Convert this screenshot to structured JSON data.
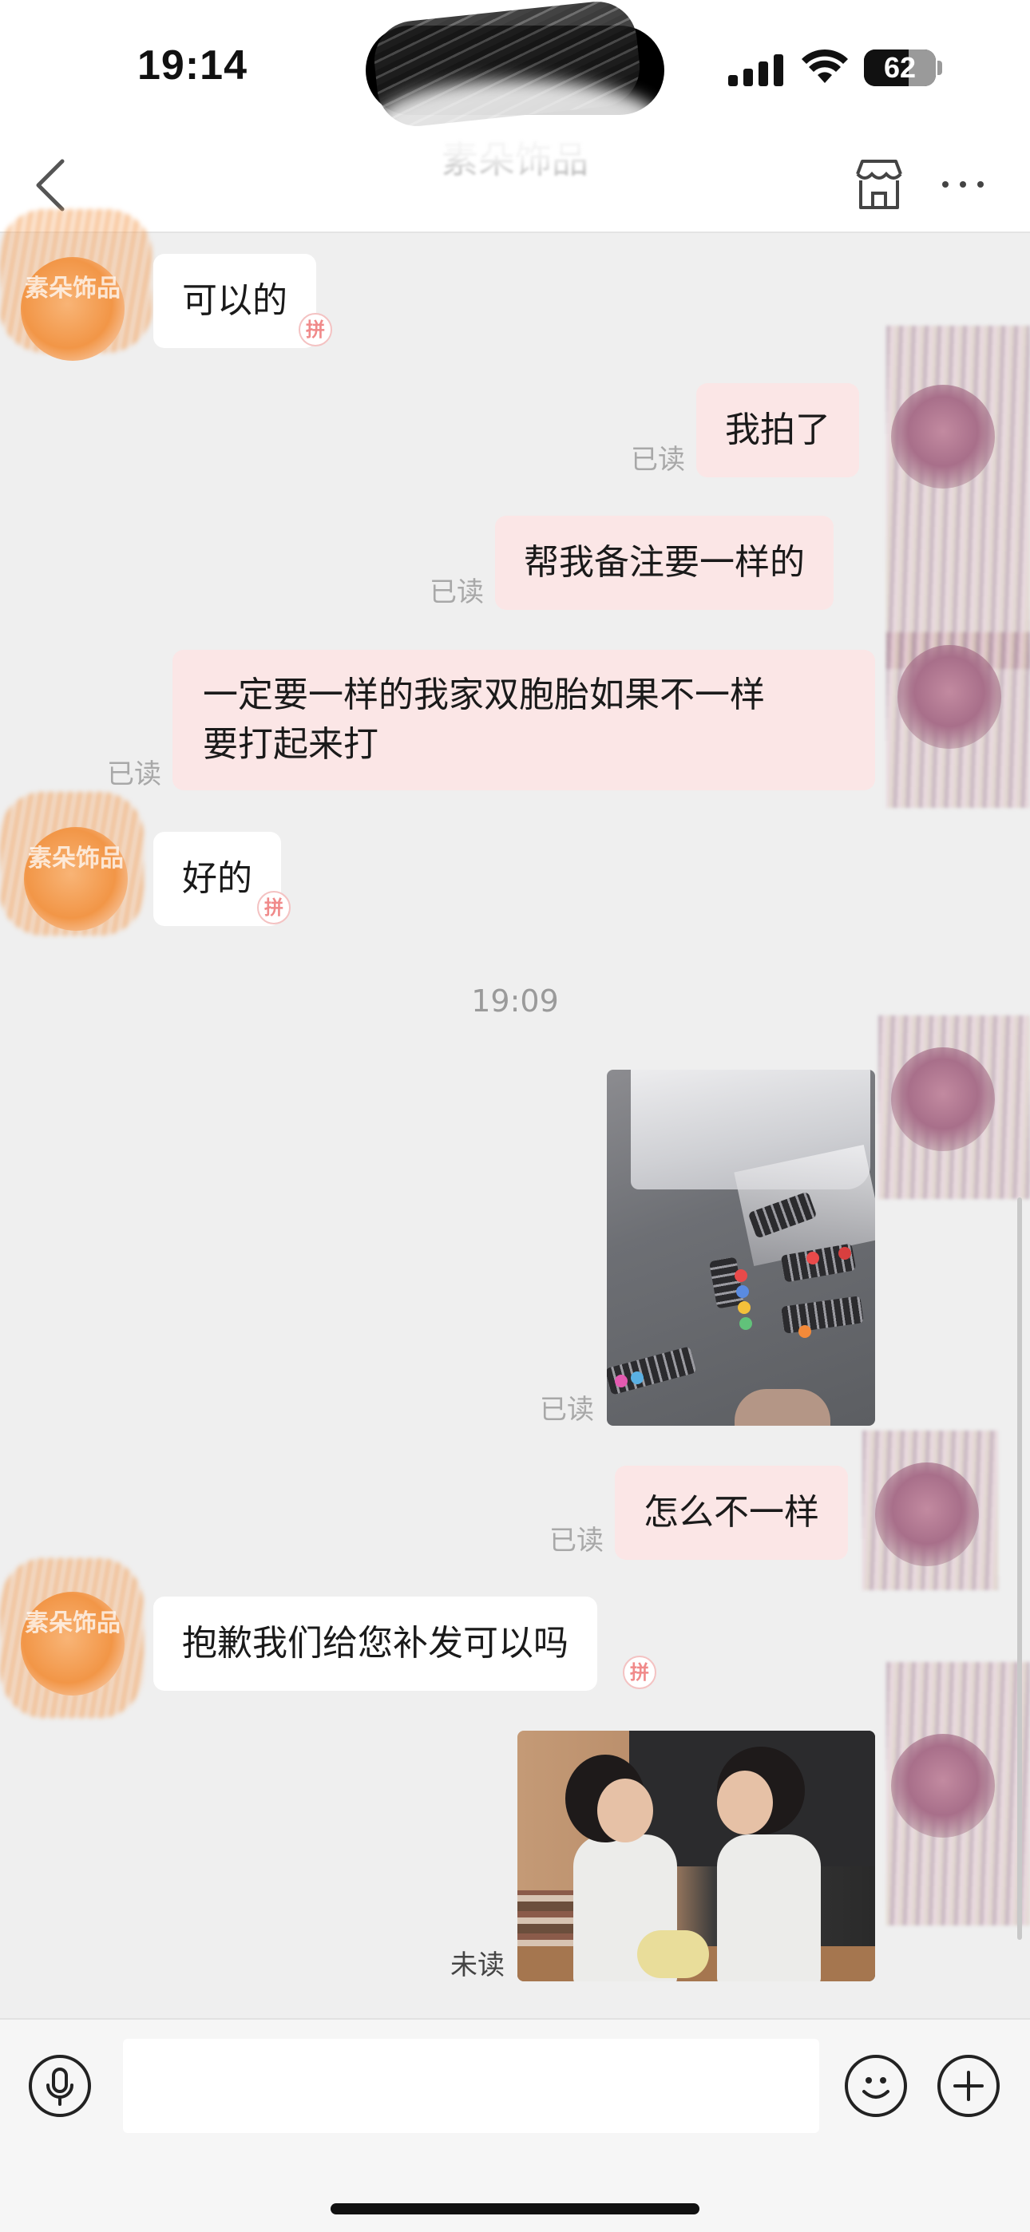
{
  "status_bar": {
    "time": "19:14",
    "battery": "62",
    "battery_fraction": 0.62,
    "signal_icon": "cellular-signal-icon",
    "wifi_icon": "wifi-icon"
  },
  "nav": {
    "title": "素朵饰品",
    "back_icon": "chevron-left-icon",
    "shop_icon": "shop-icon",
    "more_icon": "ellipsis-icon"
  },
  "messages": [
    {
      "from": "shop",
      "type": "text",
      "text": "可以的"
    },
    {
      "from": "me",
      "type": "text",
      "text": "我拍了",
      "status": "已读"
    },
    {
      "from": "me",
      "type": "text",
      "text": "帮我备注要一样的",
      "status": "已读"
    },
    {
      "from": "me",
      "type": "text",
      "lines": [
        "一定要一样的我家双胞胎如果不一样",
        "要打起来打"
      ],
      "status": "已读"
    },
    {
      "from": "shop",
      "type": "text",
      "text": "好的"
    },
    {
      "type": "timestamp",
      "text": "19:09"
    },
    {
      "from": "me",
      "type": "image",
      "subject": "photo-hair-clips",
      "status": "已读"
    },
    {
      "from": "me",
      "type": "text",
      "text": "怎么不一样",
      "status": "已读"
    },
    {
      "from": "shop",
      "type": "text",
      "text": "抱歉我们给您补发可以吗"
    },
    {
      "from": "me",
      "type": "image",
      "subject": "photo-children",
      "status": "未读"
    }
  ],
  "shop_avatar_text": "素朵饰品",
  "badge_text": "拼",
  "input_bar": {
    "placeholder": "",
    "mic_icon": "microphone-icon",
    "emoji_icon": "smiley-icon",
    "plus_icon": "plus-icon"
  },
  "colors": {
    "background": "#efefef",
    "bubble_in": "#ffffff",
    "bubble_out": "#fbe6e6",
    "avatar_orange": "#f29647",
    "read_text": "#a8a8a8"
  }
}
